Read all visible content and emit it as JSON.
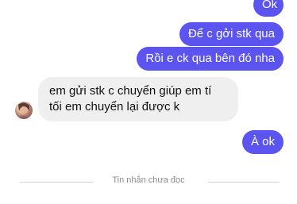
{
  "messages": [
    {
      "from": "me",
      "text": "Ok"
    },
    {
      "from": "me",
      "text": "Để c gởi stk qua"
    },
    {
      "from": "me",
      "text": "Rồi e ck qua bên đó nha"
    },
    {
      "from": "other",
      "text": "em gửi stk c chuyển giúp em tí tối em chuyển lại được k"
    },
    {
      "from": "me",
      "text": "À ok"
    }
  ],
  "unread_divider": "Tin nhắn chưa đọc",
  "colors": {
    "outgoing_bubble": "#5b54f0",
    "incoming_bubble": "#efefef",
    "divider": "#d6d6d6"
  }
}
